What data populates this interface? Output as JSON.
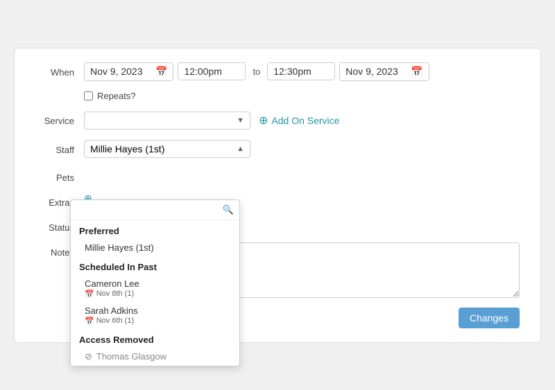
{
  "header": {
    "when_label": "When",
    "service_label": "Service",
    "staff_label": "Staff",
    "pets_label": "Pets",
    "extras_label": "Extras",
    "status_label": "Status",
    "notes_label": "Notes"
  },
  "when": {
    "date_start": "Nov 9, 2023",
    "time_start": "12:00pm",
    "to_label": "to",
    "time_end": "12:30pm",
    "date_end": "Nov 9, 2023"
  },
  "repeats": {
    "label": "Repeats?"
  },
  "service": {
    "value": "",
    "placeholder": "",
    "add_on_label": "Add On Service"
  },
  "staff": {
    "value": "Millie Hayes (1st)"
  },
  "dropdown": {
    "search_placeholder": "",
    "preferred_label": "Preferred",
    "preferred_items": [
      {
        "name": "Millie Hayes (1st)"
      }
    ],
    "scheduled_label": "Scheduled In Past",
    "scheduled_items": [
      {
        "name": "Cameron Lee",
        "sub": "Nov 8th (1)"
      },
      {
        "name": "Sarah Adkins",
        "sub": "Nov 6th (1)"
      }
    ],
    "access_removed_label": "Access Removed",
    "access_removed_items": [
      {
        "name": "Thomas Glasgow"
      }
    ]
  },
  "save": {
    "label": "Changes"
  }
}
